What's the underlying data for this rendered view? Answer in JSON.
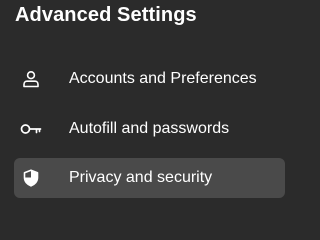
{
  "header": {
    "title": "Advanced Settings"
  },
  "nav": {
    "items": [
      {
        "label": "Accounts and Preferences",
        "icon": "person-icon",
        "selected": false
      },
      {
        "label": "Autofill and passwords",
        "icon": "key-icon",
        "selected": false
      },
      {
        "label": "Privacy and security",
        "icon": "shield-icon",
        "selected": true
      }
    ]
  },
  "colors": {
    "background": "#2b2b2b",
    "selected_background": "#4a4a4a",
    "text": "#ffffff"
  }
}
